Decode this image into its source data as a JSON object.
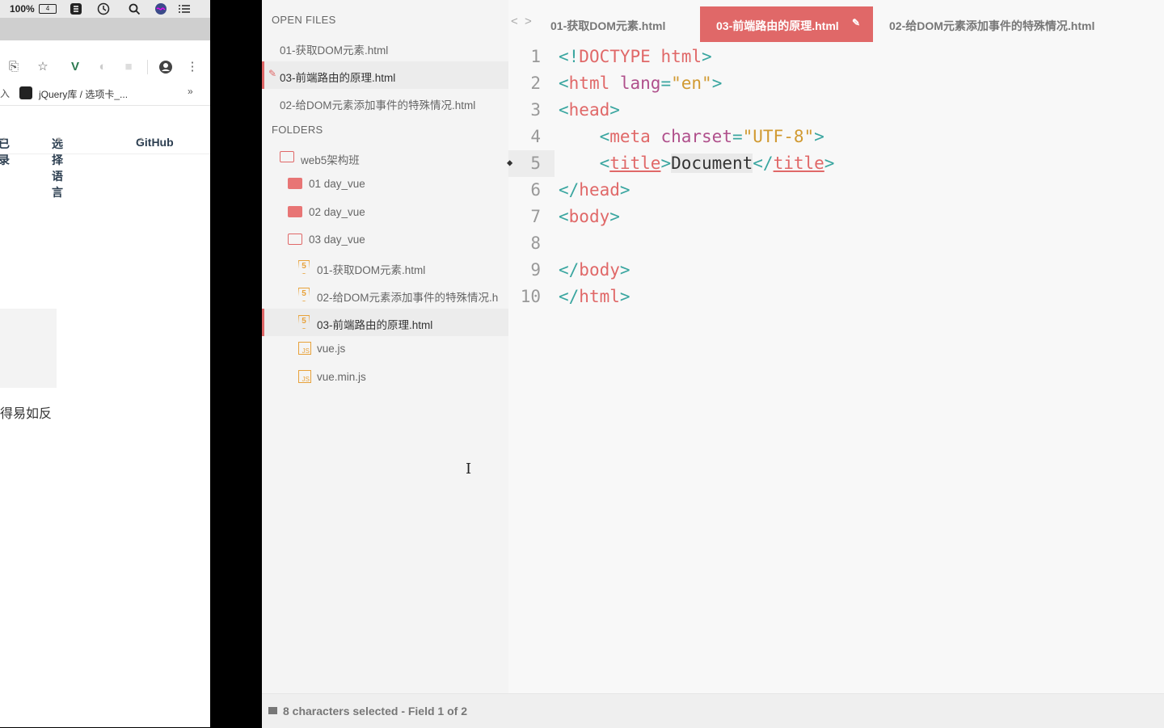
{
  "menubar": {
    "battery_percent": "100%",
    "battery_label": "4"
  },
  "browser": {
    "bookmark_label": "jQuery库 / 选项卡_...",
    "bookmark_more": "»",
    "bookmark_left_fragment": "入",
    "nav": {
      "item1": "已录",
      "item2": "选择语言",
      "item2_caret": "▾",
      "item3": "GitHub",
      "ext_icon": "↗"
    },
    "body_text": "得易如反"
  },
  "sidebar": {
    "open_files_header": "OPEN FILES",
    "open_files": [
      {
        "label": "01-获取DOM元素.html"
      },
      {
        "label": "03-前端路由的原理.html",
        "modified_icon": "✎"
      },
      {
        "label": "02-给DOM元素添加事件的特殊情况.html"
      }
    ],
    "folders_header": "FOLDERS",
    "tree": [
      {
        "label": "web5架构班"
      },
      {
        "label": "01 day_vue"
      },
      {
        "label": "02 day_vue"
      },
      {
        "label": "03 day_vue"
      },
      {
        "label": "01-获取DOM元素.html"
      },
      {
        "label": "02-给DOM元素添加事件的特殊情况.h"
      },
      {
        "label": "03-前端路由的原理.html"
      },
      {
        "label": "vue.js"
      },
      {
        "label": "vue.min.js"
      }
    ],
    "html_icon_glyph": "5",
    "js_icon_glyph": "JS"
  },
  "tabs": {
    "back": "<",
    "forward": ">",
    "items": [
      {
        "label": "01-获取DOM元素.html"
      },
      {
        "label": "03-前端路由的原理.html",
        "modified_icon": "✎"
      },
      {
        "label": "02-给DOM元素添加事件的特殊情况.html"
      }
    ]
  },
  "code": {
    "line_numbers": [
      "1",
      "2",
      "3",
      "4",
      "5",
      "6",
      "7",
      "8",
      "9",
      "10"
    ],
    "bookmark_icon": "◆",
    "l1": {
      "open": "<!",
      "tag": "DOCTYPE html",
      "close": ">"
    },
    "l2": {
      "open": "<",
      "tag": "html",
      "attr": " lang",
      "eq": "=",
      "val": "\"en\"",
      "close": ">"
    },
    "l3": {
      "open": "<",
      "tag": "head",
      "close": ">"
    },
    "l4": {
      "indent": "    ",
      "open": "<",
      "tag": "meta",
      "attr": " charset",
      "eq": "=",
      "val": "\"UTF-8\"",
      "close": ">"
    },
    "l5": {
      "indent": "    ",
      "open": "<",
      "tag": "title",
      "close": ">",
      "content": "Document",
      "open2": "</",
      "tag2": "title",
      "close2": ">"
    },
    "l6": {
      "open": "</",
      "tag": "head",
      "close": ">"
    },
    "l7": {
      "open": "<",
      "tag": "body",
      "close": ">"
    },
    "l9": {
      "open": "</",
      "tag": "body",
      "close": ">"
    },
    "l10": {
      "open": "</",
      "tag": "html",
      "close": ">"
    }
  },
  "status": {
    "text": "8 characters selected - Field 1 of 2"
  },
  "cursor_glyph": "I"
}
